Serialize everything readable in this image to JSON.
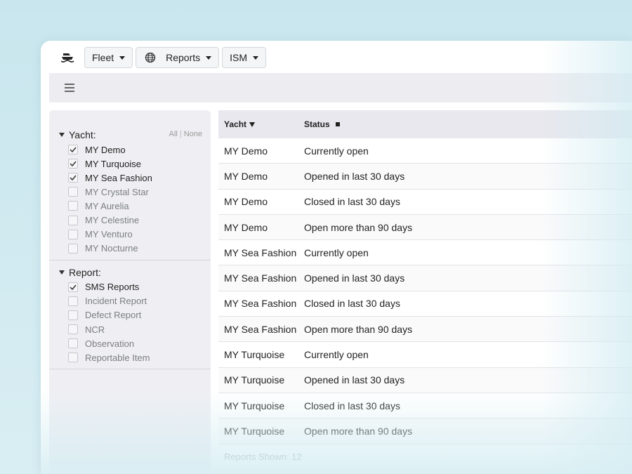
{
  "topbar": {
    "logo_icon": "ship-icon",
    "menus": [
      {
        "label": "Fleet",
        "icon": null
      },
      {
        "label": "Reports",
        "icon": "globe-icon"
      },
      {
        "label": "ISM",
        "icon": null
      }
    ]
  },
  "toolbar": {
    "menu_icon": "hamburger-icon"
  },
  "sidebar": {
    "groups": [
      {
        "title": "Yacht:",
        "all_label": "All",
        "none_label": "None",
        "items": [
          {
            "label": "MY Demo",
            "checked": true
          },
          {
            "label": "MY Turquoise",
            "checked": true
          },
          {
            "label": "MY Sea Fashion",
            "checked": true
          },
          {
            "label": "MY Crystal Star",
            "checked": false
          },
          {
            "label": "MY Aurelia",
            "checked": false
          },
          {
            "label": "MY Celestine",
            "checked": false
          },
          {
            "label": "MY Venturo",
            "checked": false
          },
          {
            "label": "MY Nocturne",
            "checked": false
          }
        ]
      },
      {
        "title": "Report:",
        "items": [
          {
            "label": "SMS Reports",
            "checked": true
          },
          {
            "label": "Incident Report",
            "checked": false
          },
          {
            "label": "Defect Report",
            "checked": false
          },
          {
            "label": "NCR",
            "checked": false
          },
          {
            "label": "Observation",
            "checked": false
          },
          {
            "label": "Reportable Item",
            "checked": false
          }
        ]
      }
    ]
  },
  "table": {
    "headers": {
      "yacht": "Yacht",
      "status": "Status"
    },
    "rows": [
      {
        "yacht": "MY Demo",
        "status": "Currently open"
      },
      {
        "yacht": "MY Demo",
        "status": "Opened in last 30 days"
      },
      {
        "yacht": "MY Demo",
        "status": "Closed in last 30 days"
      },
      {
        "yacht": "MY Demo",
        "status": "Open more than 90 days"
      },
      {
        "yacht": "MY Sea Fashion",
        "status": "Currently open"
      },
      {
        "yacht": "MY Sea Fashion",
        "status": "Opened in last 30 days"
      },
      {
        "yacht": "MY Sea Fashion",
        "status": "Closed in last 30 days"
      },
      {
        "yacht": "MY Sea Fashion",
        "status": "Open more than 90 days"
      },
      {
        "yacht": "MY Turquoise",
        "status": "Currently open"
      },
      {
        "yacht": "MY Turquoise",
        "status": "Opened in last 30 days"
      },
      {
        "yacht": "MY Turquoise",
        "status": "Closed in last 30 days"
      },
      {
        "yacht": "MY Turquoise",
        "status": "Open more than 90 days"
      }
    ],
    "footer": "Reports Shown: 12"
  }
}
